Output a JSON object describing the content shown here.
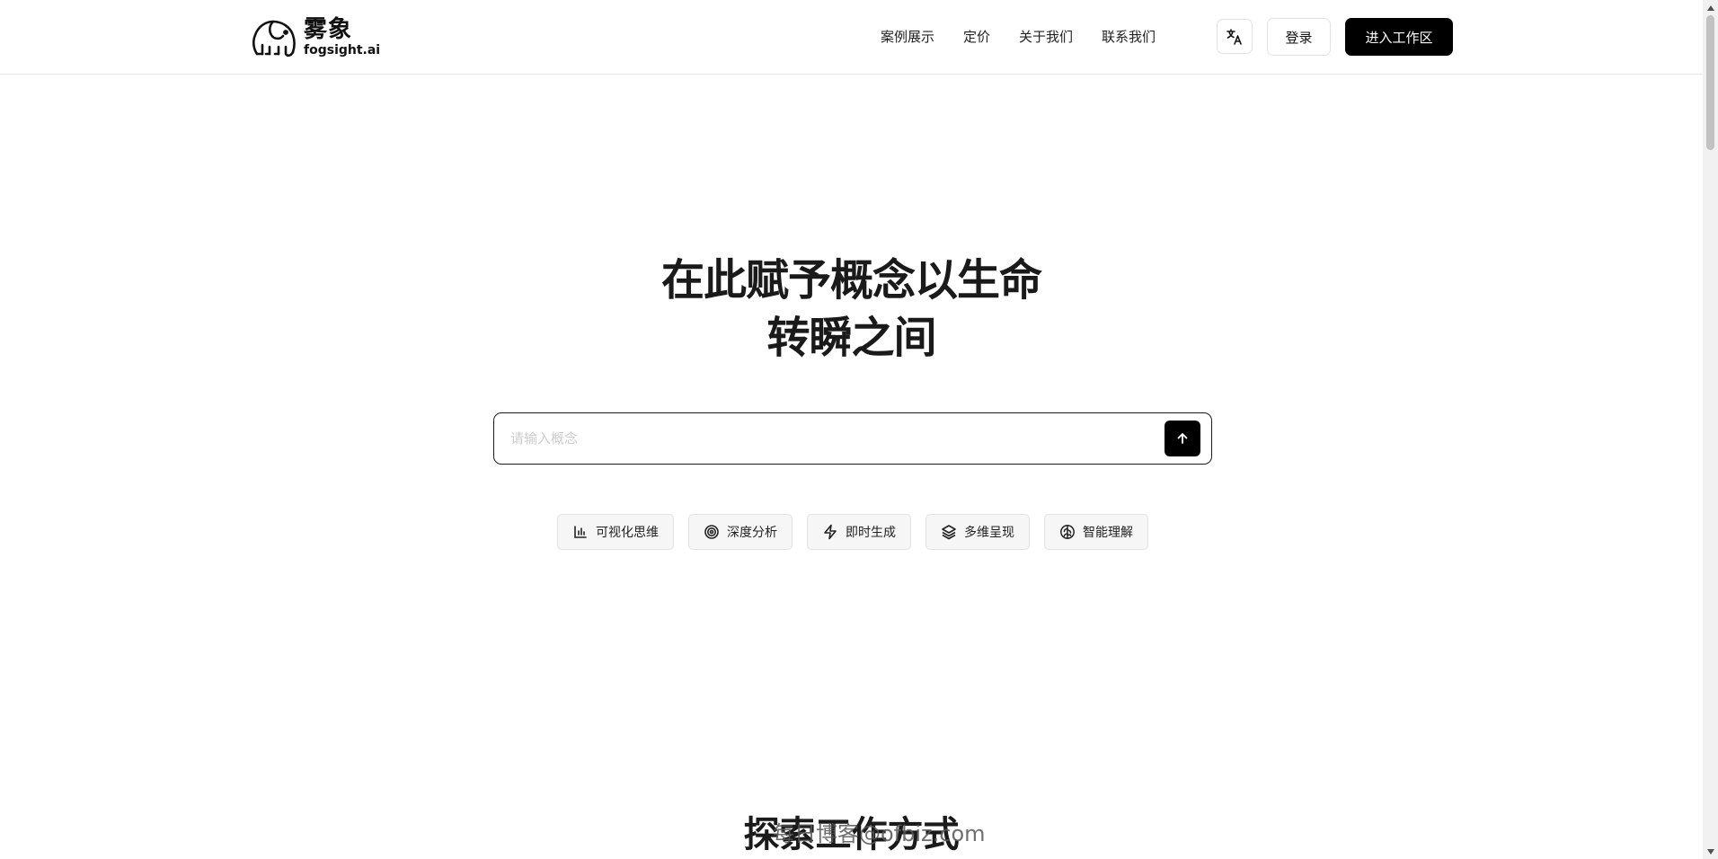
{
  "header": {
    "logo_cn": "雾象",
    "logo_en": "fogsight.ai",
    "nav": [
      {
        "label": "案例展示"
      },
      {
        "label": "定价"
      },
      {
        "label": "关于我们"
      },
      {
        "label": "联系我们"
      }
    ],
    "translate_icon": "translate-icon",
    "login_label": "登录",
    "workspace_label": "进入工作区"
  },
  "hero": {
    "title_line1": "在此赋予概念以生命",
    "title_line2": "转瞬之间",
    "search_placeholder": "请输入概念",
    "send_icon": "arrow-up-icon"
  },
  "chips": [
    {
      "label": "可视化思维",
      "icon": "bar-chart-icon"
    },
    {
      "label": "深度分析",
      "icon": "target-icon"
    },
    {
      "label": "即时生成",
      "icon": "lightning-icon"
    },
    {
      "label": "多维呈现",
      "icon": "layers-icon"
    },
    {
      "label": "智能理解",
      "icon": "brain-icon"
    }
  ],
  "section": {
    "title": "探索工作方式"
  },
  "watermark": "每日博客@ofbiz.com"
}
